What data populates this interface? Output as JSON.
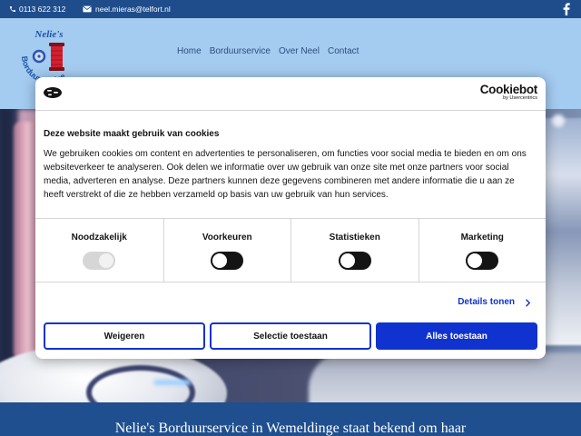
{
  "colors": {
    "topbar_bg": "#1f4d8c",
    "header_bg": "#a4cbf0",
    "nav_text": "#2b4f7d",
    "accent": "#1032cf",
    "band_bg": "#1f4f8e",
    "logo_blue": "#1d55a8",
    "logo_red": "#d3202f"
  },
  "topbar": {
    "phone_icon": "phone-icon",
    "phone": "0113 622 312",
    "mail_icon": "mail-icon",
    "email": "neel.mieras@telfort.nl",
    "social_icon": "facebook-icon"
  },
  "logo": {
    "top_text": "Nelie's",
    "ring_text": "Borduurservice",
    "graphic": "thread-spool-icon"
  },
  "nav": {
    "items": [
      {
        "label": "Home"
      },
      {
        "label": "Borduurservice"
      },
      {
        "label": "Over Neel"
      },
      {
        "label": "Contact"
      }
    ]
  },
  "cookie_dialog": {
    "icon": "cookie-icon",
    "brand": "Cookiebot",
    "brand_sub": "by Usercentrics",
    "title": "Deze website maakt gebruik van cookies",
    "body_lines": [
      "We gebruiken cookies om content en advertenties te personaliseren, om functies voor social media te bieden en om ons",
      "websiteverkeer te analyseren. Ook delen we informatie over uw gebruik van onze site met onze partners voor social",
      "media, adverteren en analyse. Deze partners kunnen deze gegevens combineren met andere informatie die u aan ze",
      "heeft verstrekt of die ze hebben verzameld op basis van uw gebruik van hun services."
    ],
    "categories": [
      {
        "label": "Noodzakelijk",
        "checked": true,
        "disabled": true
      },
      {
        "label": "Voorkeuren",
        "checked": false,
        "disabled": false
      },
      {
        "label": "Statistieken",
        "checked": false,
        "disabled": false
      },
      {
        "label": "Marketing",
        "checked": false,
        "disabled": false
      }
    ],
    "details_link": "Details tonen",
    "details_icon": "chevron-right-icon",
    "buttons": {
      "decline": "Weigeren",
      "allow_selection": "Selectie toestaan",
      "allow_all": "Alles toestaan"
    }
  },
  "intro": {
    "heading": "Nelie's Borduurservice in Wemeldinge staat bekend om haar"
  }
}
